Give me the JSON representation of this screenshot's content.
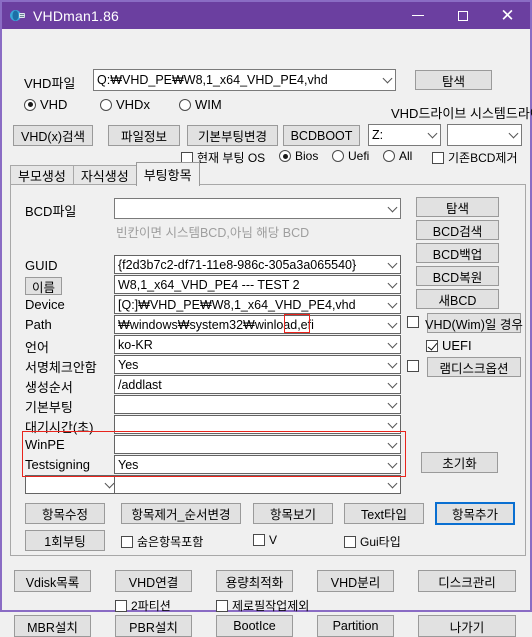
{
  "window": {
    "title": "VHDman1.86",
    "icon": "vhd-app-icon",
    "minimize": "—",
    "maximize": "□",
    "close": "✕",
    "accent": "#6b3fa0",
    "border": "#8a6cc4"
  },
  "top": {
    "vhdfile_label": "VHD파일",
    "vhdfile_value": "Q:₩VHD_PE₩W8,1_x64_VHD_PE4,vhd",
    "browse_label": "탐색",
    "types": [
      {
        "label": "VHD",
        "selected": true
      },
      {
        "label": "VHDx",
        "selected": false
      },
      {
        "label": "WIM",
        "selected": false
      }
    ],
    "vhd_drive_label": "VHD드라이브",
    "system_drive_label": "시스템드라이브",
    "vhd_drive_value": "Z:",
    "system_drive_value": ""
  },
  "toolbar": {
    "vhdx_search": "VHD(x)검색",
    "file_info": "파일정보",
    "default_boot_change": "기본부팅변경",
    "bcdboot": "BCDBOOT",
    "current_boot_os": "현재 부팅 OS",
    "current_boot_os_checked": false,
    "firmware": [
      {
        "label": "Bios",
        "selected": true
      },
      {
        "label": "Uefi",
        "selected": false
      },
      {
        "label": "All",
        "selected": false
      }
    ],
    "remove_existing_bcd": "기존BCD제거",
    "remove_existing_bcd_checked": false
  },
  "tabs": [
    {
      "label": "부모생성",
      "active": false
    },
    {
      "label": "자식생성",
      "active": false
    },
    {
      "label": "부팅항목",
      "active": true
    }
  ],
  "panel": {
    "bcdfile_label": "BCD파일",
    "bcdfile_value": "",
    "bcdfile_hint": "빈칸이면 시스템BCD,아님 해당 BCD",
    "fields": [
      {
        "name": "guid",
        "label": "GUID",
        "value": "{f2d3b7c2-df71-11e8-986c-305a3a065540}"
      },
      {
        "name": "name",
        "label": "이름",
        "value": "W8,1_x64_VHD_PE4 --- TEST 2",
        "label_is_button": true
      },
      {
        "name": "device",
        "label": "Device",
        "value": "[Q:]₩VHD_PE₩W8,1_x64_VHD_PE4,vhd"
      },
      {
        "name": "path",
        "label": "Path",
        "value": "₩windows₩system32₩winload,efi",
        "highlight_tail": "efi"
      },
      {
        "name": "locale",
        "label": "언어",
        "value": "ko-KR"
      },
      {
        "name": "nointegrity",
        "label": "서명체크안함",
        "value": "Yes"
      },
      {
        "name": "order",
        "label": "생성순서",
        "value": "/addlast"
      },
      {
        "name": "defaultboot",
        "label": "기본부팅",
        "value": ""
      },
      {
        "name": "timeout",
        "label": "대기시간(초)",
        "value": ""
      },
      {
        "name": "winpe",
        "label": "WinPE",
        "value": ""
      },
      {
        "name": "testsigning",
        "label": "Testsigning",
        "value": "Yes"
      }
    ],
    "extra_small_combo": "",
    "extra_wide_combo": "",
    "side_buttons": [
      {
        "name": "browse",
        "label": "탐색"
      },
      {
        "name": "bcd-search",
        "label": "BCD검색"
      },
      {
        "name": "bcd-backup",
        "label": "BCD백업"
      },
      {
        "name": "bcd-restore",
        "label": "BCD복원"
      },
      {
        "name": "new-bcd",
        "label": "새BCD"
      }
    ],
    "vhd_wim_case_label": "VHD(Wim)일 경우",
    "vhd_wim_case_checked": false,
    "uefi_label": "UEFI",
    "uefi_checked": true,
    "ramdisk_label": "램디스크옵션",
    "ramdisk_checked": false,
    "reset_label": "초기화",
    "action_buttons": [
      {
        "name": "edit-item",
        "label": "항목수정",
        "focused": false
      },
      {
        "name": "remove-item",
        "label": "항목제거_순서변경",
        "focused": false
      },
      {
        "name": "view-item",
        "label": "항목보기",
        "focused": false
      },
      {
        "name": "text-type",
        "label": "Text타입",
        "focused": false
      },
      {
        "name": "add-item",
        "label": "항목추가",
        "focused": true
      }
    ],
    "boot_once_label": "1회부팅",
    "bottom_checks": [
      {
        "name": "include-hidden",
        "label": "숨은항목포함",
        "checked": false
      },
      {
        "name": "v-option",
        "label": "V",
        "checked": false
      },
      {
        "name": "gui-type",
        "label": "Gui타입",
        "checked": false
      }
    ]
  },
  "bottom": {
    "row1": [
      {
        "name": "vdisk-list",
        "label": "Vdisk목록"
      },
      {
        "name": "vhd-attach",
        "label": "VHD연결"
      },
      {
        "name": "optimize",
        "label": "용량최적화"
      },
      {
        "name": "vhd-detach",
        "label": "VHD분리"
      },
      {
        "name": "disk-manage",
        "label": "디스크관리"
      }
    ],
    "checks": [
      {
        "name": "two-partition",
        "label": "2파티션",
        "checked": false
      },
      {
        "name": "skip-zerofill",
        "label": "제로필작업제외",
        "checked": false
      }
    ],
    "row2": [
      {
        "name": "mbr-install",
        "label": "MBR설치"
      },
      {
        "name": "pbr-install",
        "label": "PBR설치"
      },
      {
        "name": "bootice",
        "label": "BootIce"
      },
      {
        "name": "partition",
        "label": "Partition"
      },
      {
        "name": "exit",
        "label": "나가기"
      }
    ]
  }
}
